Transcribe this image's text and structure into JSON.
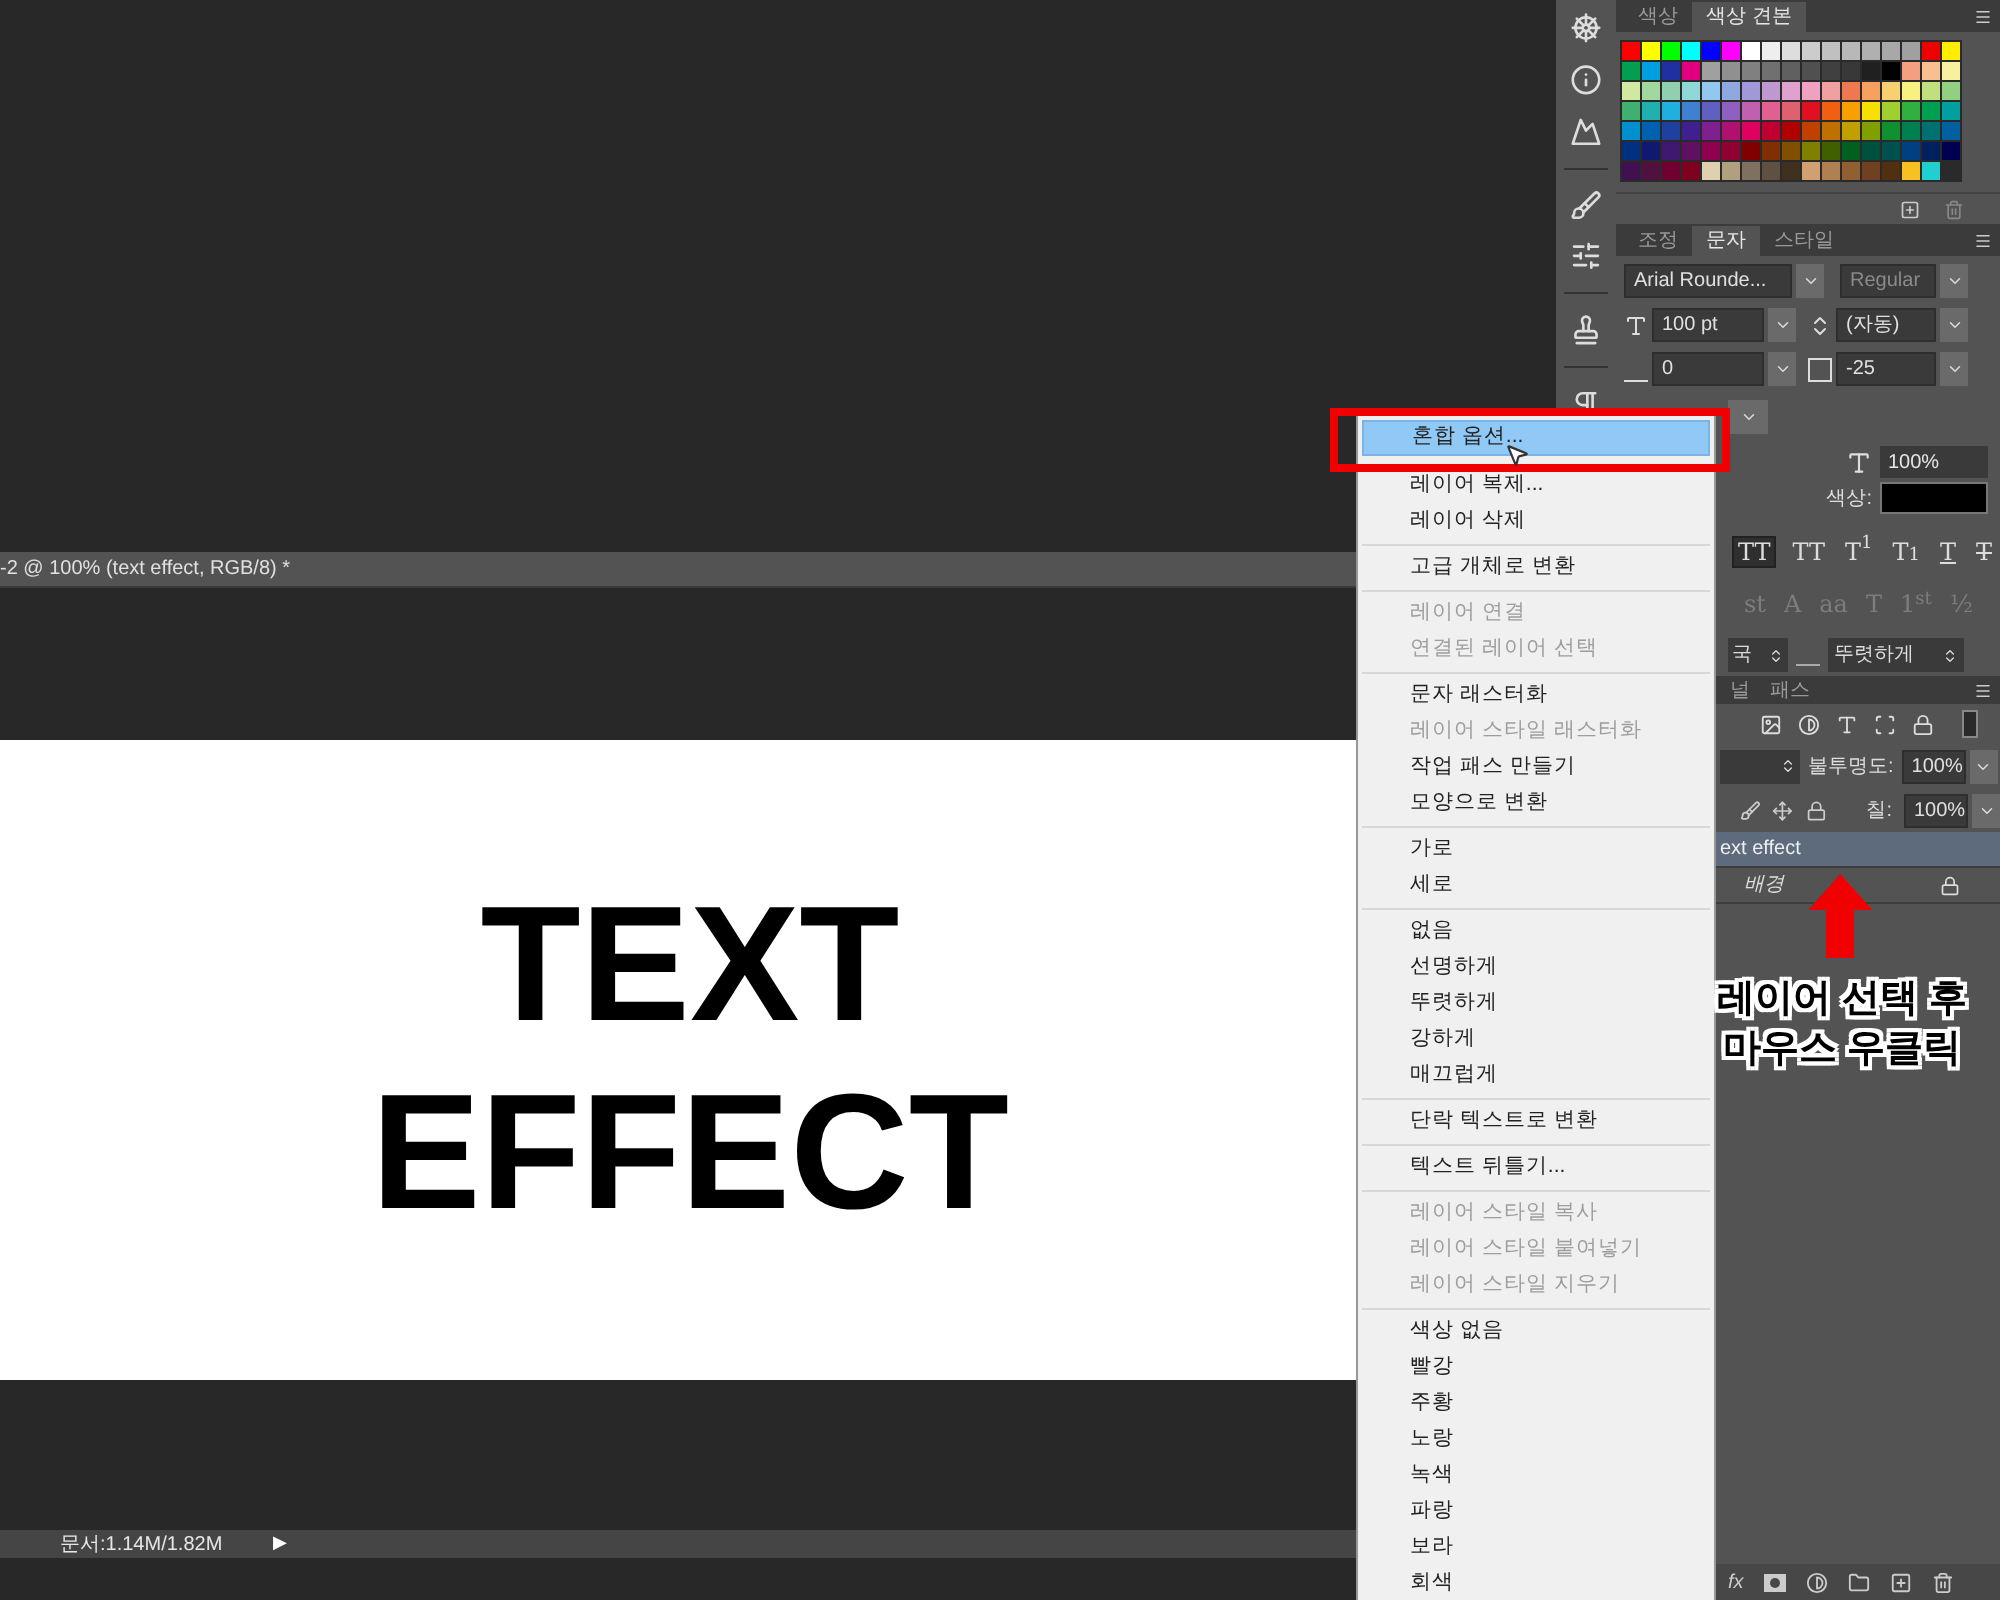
{
  "document": {
    "tab_title": "-2 @ 100% (text effect, RGB/8) *",
    "canvas_lines": [
      "TEXT",
      "EFFECT"
    ],
    "status": "문서:1.14M/1.82M",
    "status_arrow": "▶"
  },
  "swatches_panel": {
    "tabs": [
      {
        "label": "색상",
        "selected": false
      },
      {
        "label": "색상 견본",
        "selected": true
      }
    ],
    "swatch_rows": [
      [
        {
          "color": "#ff0000"
        },
        {
          "color": "#ffff00"
        },
        {
          "color": "#00ff00"
        },
        {
          "color": "#00ffff"
        },
        {
          "color": "#0000ff"
        },
        {
          "color": "#ff00ff"
        },
        {
          "color": "#ffffff"
        },
        {
          "color": "#eeeeee"
        },
        {
          "color": "#dddddd"
        },
        {
          "color": "#cccccc"
        },
        {
          "color": "#c0c0c0"
        },
        {
          "color": "#b8b8b8"
        },
        {
          "color": "#b0b0b0"
        },
        {
          "color": "#a8a8a8"
        },
        {
          "color": "#a0a0a0"
        },
        {
          "color": "#ee0000"
        },
        {
          "color": "#ffee00"
        }
      ],
      [
        {
          "color": "#00a050"
        },
        {
          "color": "#00a0e0"
        },
        {
          "color": "#2030a0"
        },
        {
          "color": "#e00080"
        },
        {
          "color": "#a0a0a0"
        },
        {
          "color": "#909090"
        },
        {
          "color": "#808080"
        },
        {
          "color": "#707070"
        },
        {
          "color": "#606060"
        },
        {
          "color": "#505050"
        },
        {
          "color": "#404040"
        },
        {
          "color": "#383838"
        },
        {
          "color": "#202020"
        },
        {
          "color": "#000000"
        },
        {
          "color": "#f4a080"
        },
        {
          "color": "#f8c090"
        },
        {
          "color": "#f8f0a0"
        }
      ],
      [
        {
          "color": "#d0e8a0"
        },
        {
          "color": "#a0d8a0"
        },
        {
          "color": "#90d0b0"
        },
        {
          "color": "#90d8d8"
        },
        {
          "color": "#90c8f0"
        },
        {
          "color": "#90a8e0"
        },
        {
          "color": "#a098d8"
        },
        {
          "color": "#c098d0"
        },
        {
          "color": "#e0a0d0"
        },
        {
          "color": "#f0a0c0"
        },
        {
          "color": "#f0a0a0"
        },
        {
          "color": "#f07850"
        },
        {
          "color": "#f8a060"
        },
        {
          "color": "#f8d070"
        },
        {
          "color": "#f8f080"
        },
        {
          "color": "#c0e080"
        },
        {
          "color": "#90d080"
        }
      ],
      [
        {
          "color": "#40b070"
        },
        {
          "color": "#20b0b0"
        },
        {
          "color": "#20b0e0"
        },
        {
          "color": "#4080d0"
        },
        {
          "color": "#6060c0"
        },
        {
          "color": "#9060c0"
        },
        {
          "color": "#c060b0"
        },
        {
          "color": "#e06090"
        },
        {
          "color": "#e06070"
        },
        {
          "color": "#e01020"
        },
        {
          "color": "#f06010"
        },
        {
          "color": "#f8a000"
        },
        {
          "color": "#f8e000"
        },
        {
          "color": "#a0d030"
        },
        {
          "color": "#30b040"
        },
        {
          "color": "#00a050"
        },
        {
          "color": "#00a0a0"
        }
      ],
      [
        {
          "color": "#0090d0"
        },
        {
          "color": "#0060b0"
        },
        {
          "color": "#2040a0"
        },
        {
          "color": "#402090"
        },
        {
          "color": "#802090"
        },
        {
          "color": "#b01070"
        },
        {
          "color": "#e00060"
        },
        {
          "color": "#c00030"
        },
        {
          "color": "#b00000"
        },
        {
          "color": "#c04000"
        },
        {
          "color": "#c07000"
        },
        {
          "color": "#c0a000"
        },
        {
          "color": "#80a000"
        },
        {
          "color": "#109030"
        },
        {
          "color": "#008050"
        },
        {
          "color": "#007070"
        },
        {
          "color": "#0060a0"
        }
      ],
      [
        {
          "color": "#003080"
        },
        {
          "color": "#101870"
        },
        {
          "color": "#401870"
        },
        {
          "color": "#601060"
        },
        {
          "color": "#900050"
        },
        {
          "color": "#900030"
        },
        {
          "color": "#800000"
        },
        {
          "color": "#803000"
        },
        {
          "color": "#805000"
        },
        {
          "color": "#808000"
        },
        {
          "color": "#406000"
        },
        {
          "color": "#006020"
        },
        {
          "color": "#005040"
        },
        {
          "color": "#005050"
        },
        {
          "color": "#004080"
        },
        {
          "color": "#002060"
        },
        {
          "color": "#000050"
        }
      ],
      [
        {
          "color": "#401050"
        },
        {
          "color": "#501040"
        },
        {
          "color": "#700030"
        },
        {
          "color": "#800020"
        },
        {
          "color": "#e0d0b0"
        },
        {
          "color": "#b0a080"
        },
        {
          "color": "#807060"
        },
        {
          "color": "#605040"
        },
        {
          "color": "#403020"
        },
        {
          "color": "#d0a070"
        },
        {
          "color": "#b08050"
        },
        {
          "color": "#906030"
        },
        {
          "color": "#704020"
        },
        {
          "color": "#503010"
        },
        {
          "color": "#f8c020"
        },
        {
          "color": "#20d0d0"
        }
      ]
    ]
  },
  "character_panel": {
    "tabs": [
      {
        "label": "조정",
        "selected": false
      },
      {
        "label": "문자",
        "selected": true
      },
      {
        "label": "스타일",
        "selected": false
      }
    ],
    "font_family": "Arial Rounde...",
    "font_style": "Regular",
    "font_size": "100 pt",
    "leading": "(자동)",
    "kerning": "0",
    "tracking": "-25",
    "vertical_scale": "100%",
    "color_label": "색상:",
    "style_buttons": [
      {
        "kind": "all_caps",
        "label": "TT",
        "selected": true
      },
      {
        "kind": "small_caps",
        "label": "TT",
        "selected": false
      },
      {
        "kind": "plain",
        "label": "T$^{1}$",
        "selected": false
      },
      {
        "kind": "plain",
        "label": "T$_{1}$",
        "selected": false
      },
      {
        "kind": "underline",
        "label": "T",
        "selected": false
      },
      {
        "kind": "strike",
        "label": "T",
        "selected": false
      }
    ],
    "opentype_buttons": [
      "st",
      "A",
      "aa",
      "T",
      "1$^{st}$",
      "½"
    ],
    "language_tail": "국",
    "antialias": "뚜렷하게"
  },
  "layers_panel": {
    "tabs": [
      {
        "label": "널",
        "selected": false
      },
      {
        "label": "패스",
        "selected": false
      }
    ],
    "opacity_label": "불투명도:",
    "opacity": "100%",
    "fill_label": "칠:",
    "fill": "100%",
    "layers": [
      {
        "kind": "text",
        "name": "ext effect",
        "selected": true
      },
      {
        "kind": "background",
        "name": "배경",
        "selected": false
      }
    ],
    "style_button": "fx"
  },
  "context_menu": {
    "groups": [
      [
        {
          "label": "혼합 옵션...",
          "disabled": false,
          "selected": true
        },
        {
          "label": "레이어 복제...",
          "disabled": false,
          "selected": false
        },
        {
          "label": "레이어 삭제",
          "disabled": false,
          "selected": false
        }
      ],
      [
        {
          "label": "고급 개체로 변환",
          "disabled": false,
          "selected": false
        }
      ],
      [
        {
          "label": "레이어 연결",
          "disabled": true,
          "selected": false
        },
        {
          "label": "연결된 레이어 선택",
          "disabled": true,
          "selected": false
        }
      ],
      [
        {
          "label": "문자 래스터화",
          "disabled": false,
          "selected": false
        },
        {
          "label": "레이어 스타일 래스터화",
          "disabled": true,
          "selected": false
        },
        {
          "label": "작업 패스 만들기",
          "disabled": false,
          "selected": false
        },
        {
          "label": "모양으로 변환",
          "disabled": false,
          "selected": false
        }
      ],
      [
        {
          "label": "가로",
          "disabled": false,
          "selected": false
        },
        {
          "label": "세로",
          "disabled": false,
          "selected": false
        }
      ],
      [
        {
          "label": "없음",
          "disabled": false,
          "selected": false
        },
        {
          "label": "선명하게",
          "disabled": false,
          "selected": false
        },
        {
          "label": "뚜렷하게",
          "disabled": false,
          "selected": false
        },
        {
          "label": "강하게",
          "disabled": false,
          "selected": false
        },
        {
          "label": "매끄럽게",
          "disabled": false,
          "selected": false
        }
      ],
      [
        {
          "label": "단락 텍스트로 변환",
          "disabled": false,
          "selected": false
        }
      ],
      [
        {
          "label": "텍스트 뒤틀기...",
          "disabled": false,
          "selected": false
        }
      ],
      [
        {
          "label": "레이어 스타일 복사",
          "disabled": true,
          "selected": false
        },
        {
          "label": "레이어 스타일 붙여넣기",
          "disabled": true,
          "selected": false
        },
        {
          "label": "레이어 스타일 지우기",
          "disabled": true,
          "selected": false
        }
      ],
      [
        {
          "label": "색상 없음",
          "disabled": false,
          "selected": false
        },
        {
          "label": "빨강",
          "disabled": false,
          "selected": false
        },
        {
          "label": "주황",
          "disabled": false,
          "selected": false
        },
        {
          "label": "노랑",
          "disabled": false,
          "selected": false
        },
        {
          "label": "녹색",
          "disabled": false,
          "selected": false
        },
        {
          "label": "파랑",
          "disabled": false,
          "selected": false
        },
        {
          "label": "보라",
          "disabled": false,
          "selected": false
        },
        {
          "label": "회색",
          "disabled": false,
          "selected": false
        }
      ]
    ]
  },
  "annotation": {
    "lines": [
      "레이어 선택 후",
      "마우스 우클릭"
    ]
  }
}
